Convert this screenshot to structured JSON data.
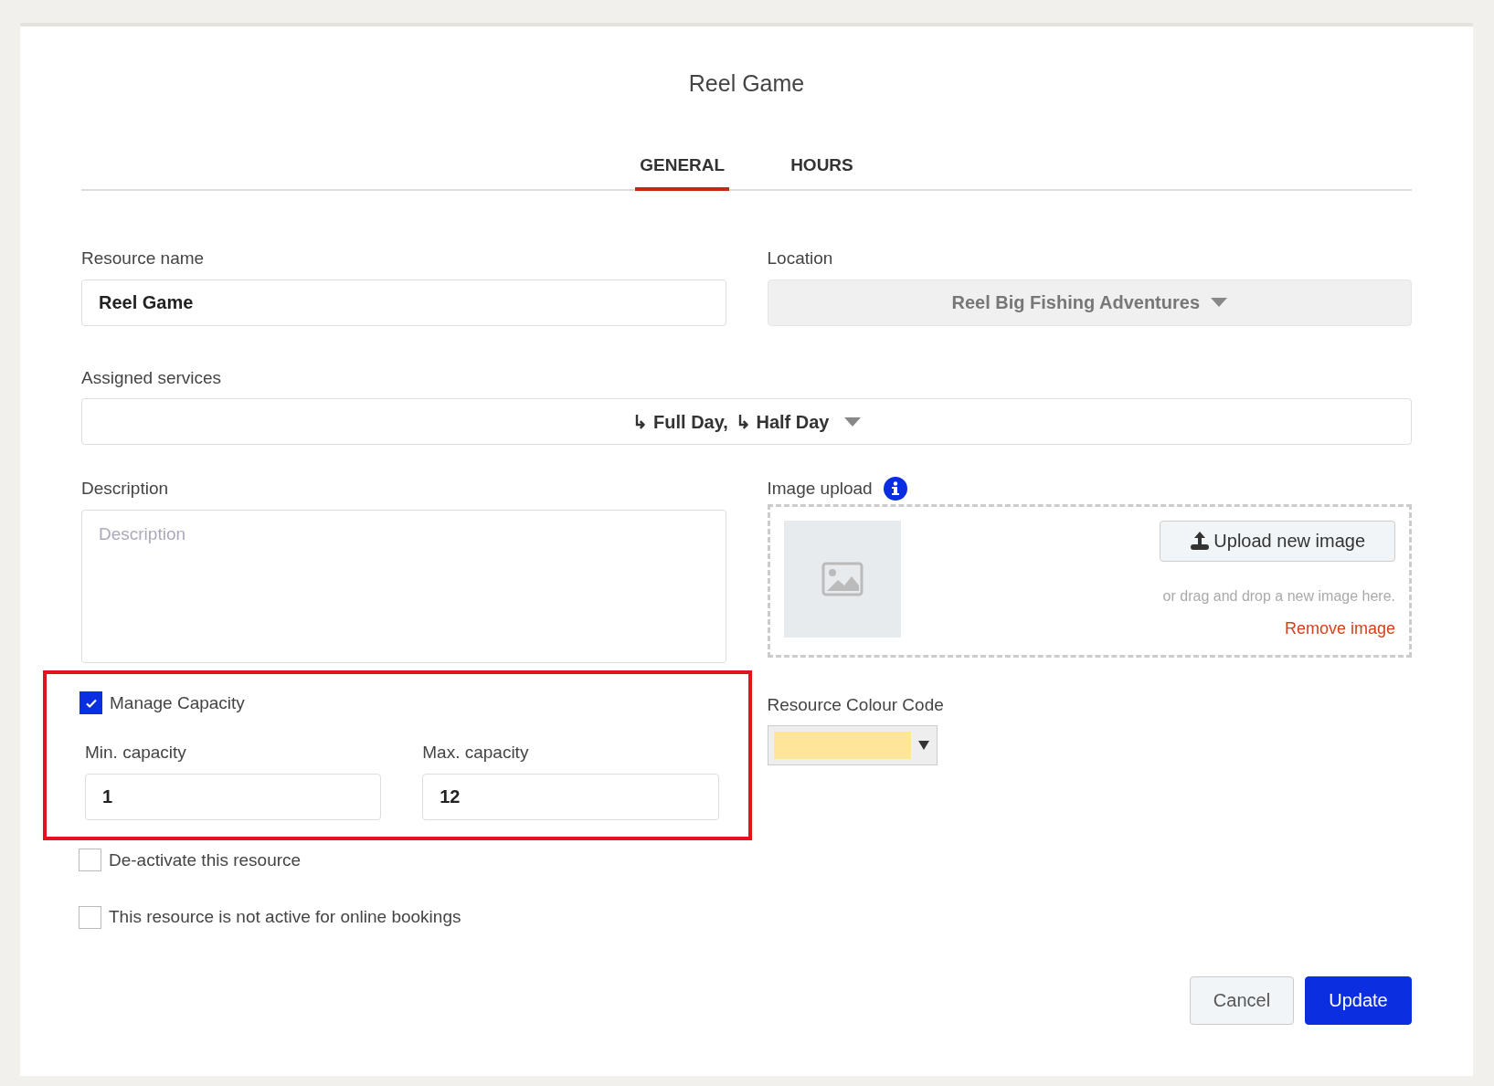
{
  "dialog": {
    "title": "Reel Game"
  },
  "tabs": [
    {
      "label": "GENERAL",
      "selected": true
    },
    {
      "label": "HOURS",
      "selected": false
    }
  ],
  "resource_name": {
    "label": "Resource name",
    "value": "Reel Game"
  },
  "location": {
    "label": "Location",
    "value": "Reel Big Fishing Adventures"
  },
  "assigned_services": {
    "label": "Assigned services",
    "items": [
      "↳ Full Day,",
      "↳ Half Day"
    ]
  },
  "description": {
    "label": "Description",
    "placeholder": "Description"
  },
  "image_upload": {
    "label": "Image upload",
    "button": "Upload new image",
    "hint": "or drag and drop a new image here.",
    "remove": "Remove image"
  },
  "manage_capacity": {
    "label": "Manage Capacity",
    "checked": true,
    "highlighted": true
  },
  "min_capacity": {
    "label": "Min. capacity",
    "value": "1"
  },
  "max_capacity": {
    "label": "Max. capacity",
    "value": "12"
  },
  "colour_code": {
    "label": "Resource Colour Code",
    "color": "#fee59a"
  },
  "options": [
    {
      "label": "De-activate this resource",
      "checked": false
    },
    {
      "label": "This resource is not active for online bookings",
      "checked": false
    }
  ],
  "buttons": [
    {
      "kind": "secondary",
      "label": "Cancel"
    },
    {
      "kind": "primary",
      "label": "Update"
    }
  ]
}
